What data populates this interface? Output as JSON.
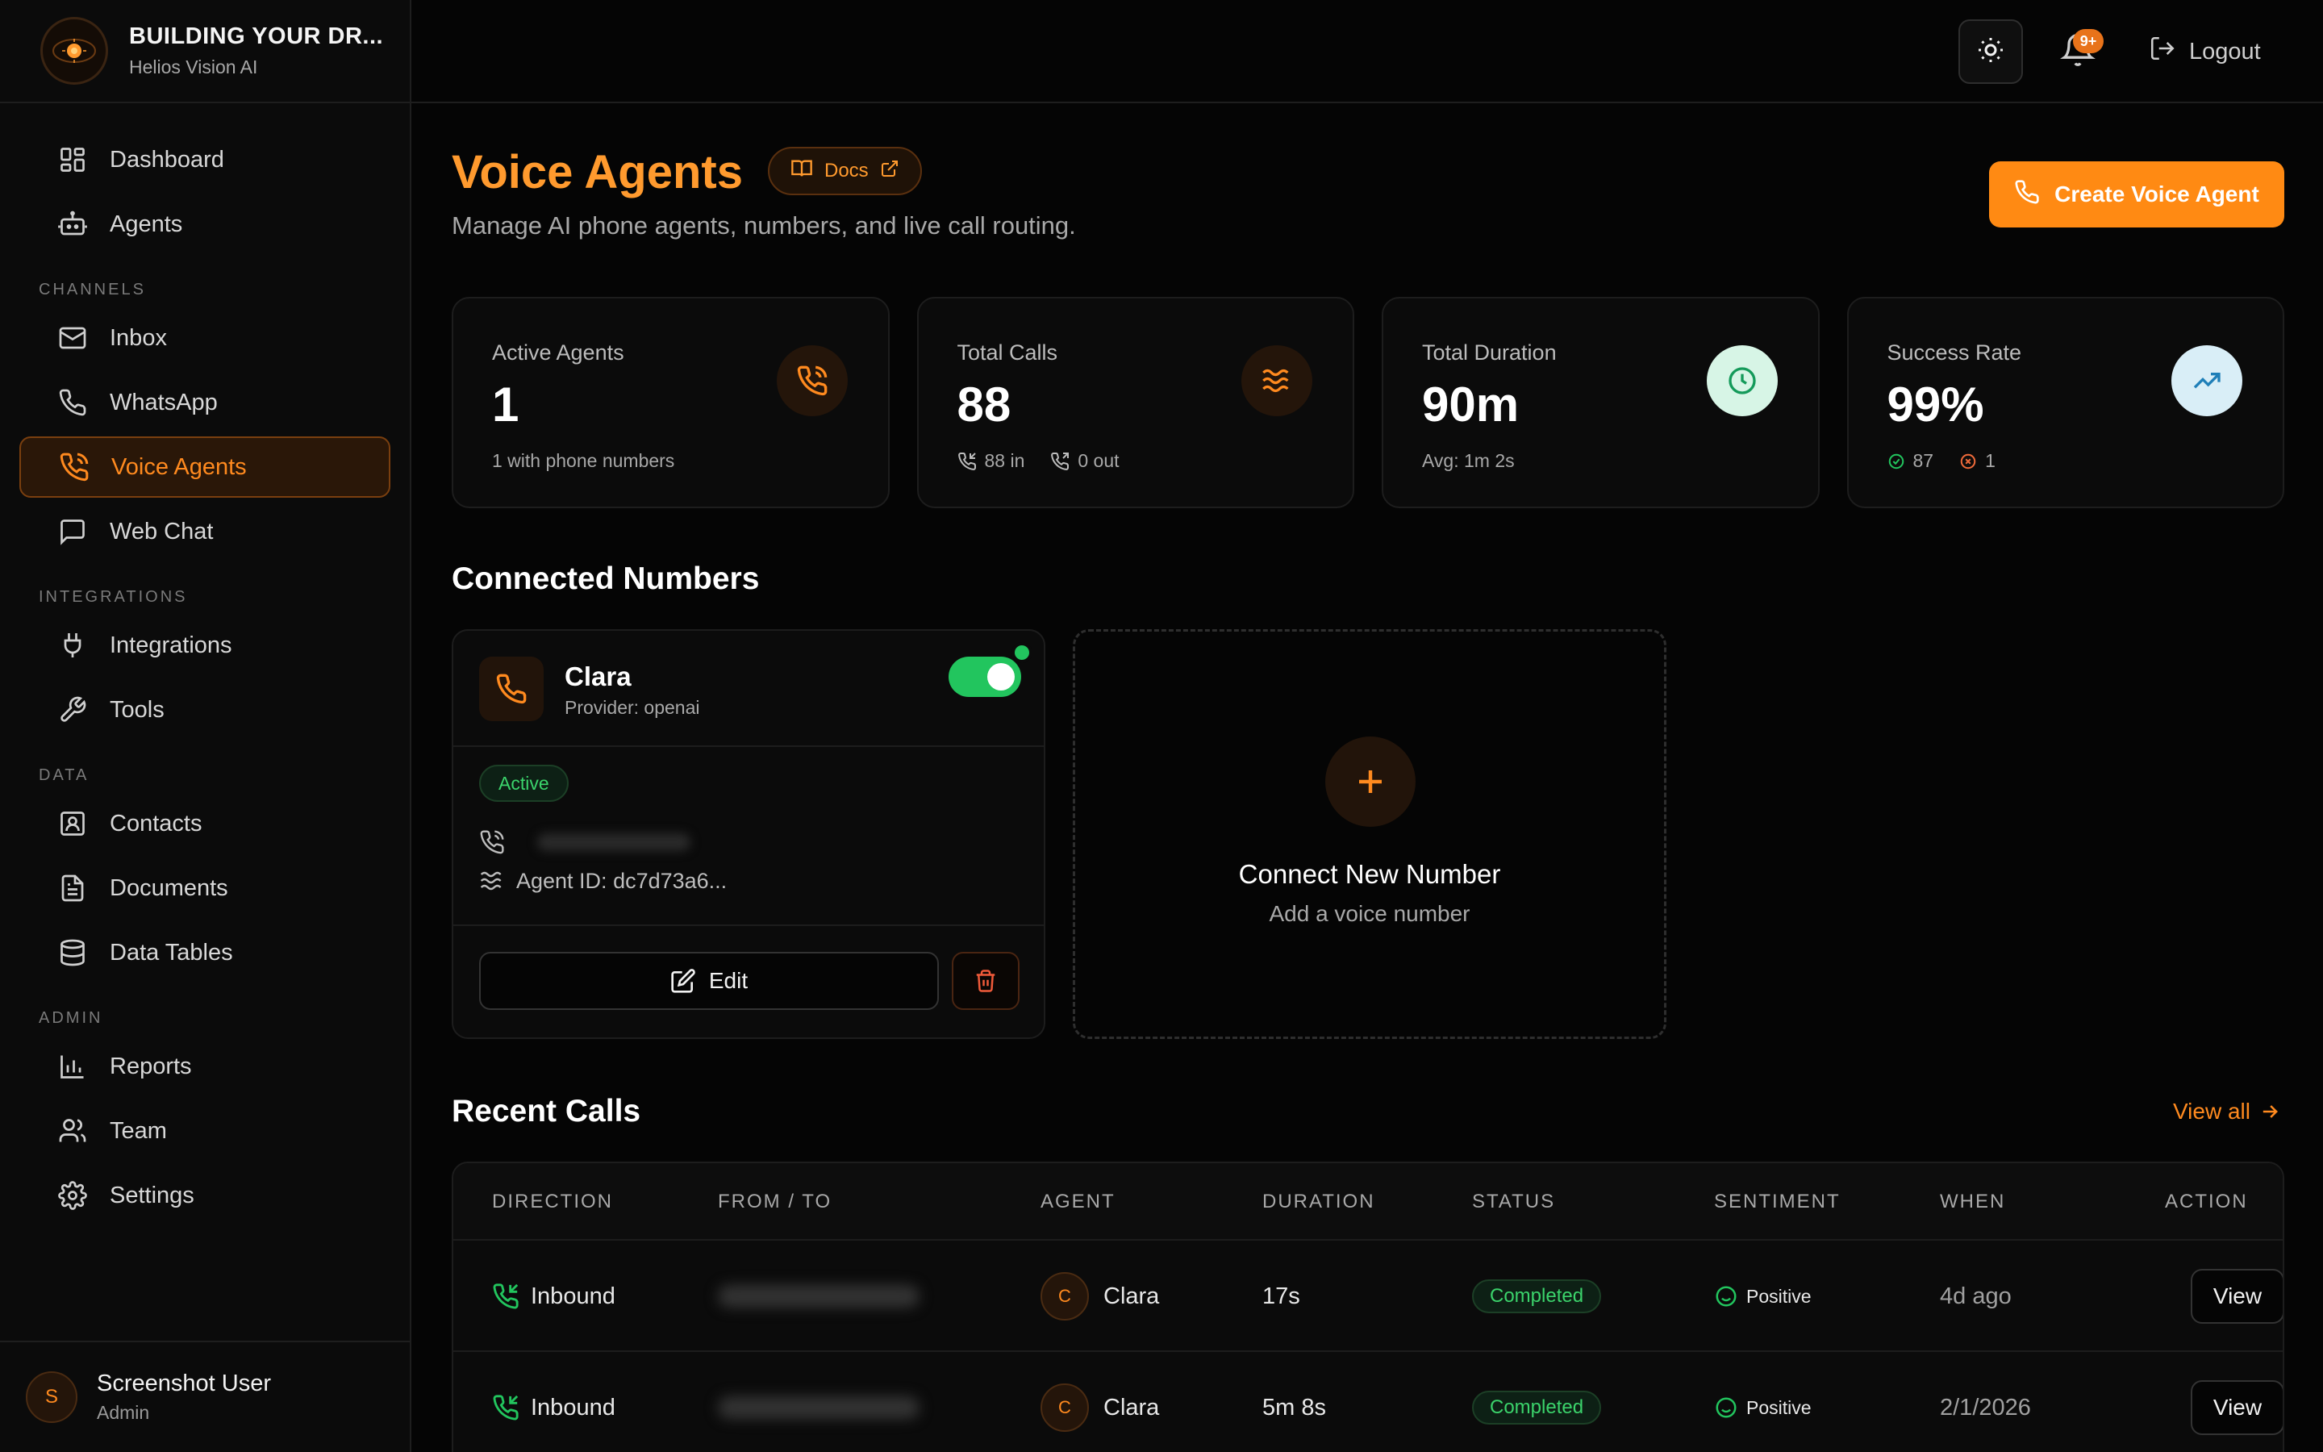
{
  "brand": {
    "title": "BUILDING YOUR DR...",
    "subtitle": "Helios Vision AI"
  },
  "colors": {
    "accent": "#ff8a13",
    "success": "#22c55e",
    "danger": "#ef4444"
  },
  "sidebar": {
    "top_items": [
      {
        "label": "Dashboard",
        "icon": "dashboard-icon"
      },
      {
        "label": "Agents",
        "icon": "bot-icon"
      }
    ],
    "sections": [
      {
        "title": "CHANNELS",
        "items": [
          {
            "label": "Inbox",
            "icon": "mail-icon"
          },
          {
            "label": "WhatsApp",
            "icon": "phone-icon"
          },
          {
            "label": "Voice Agents",
            "icon": "phone-call-icon",
            "active": true
          },
          {
            "label": "Web Chat",
            "icon": "chat-icon"
          }
        ]
      },
      {
        "title": "INTEGRATIONS",
        "items": [
          {
            "label": "Integrations",
            "icon": "plug-icon"
          },
          {
            "label": "Tools",
            "icon": "wrench-icon"
          }
        ]
      },
      {
        "title": "DATA",
        "items": [
          {
            "label": "Contacts",
            "icon": "contact-icon"
          },
          {
            "label": "Documents",
            "icon": "document-icon"
          },
          {
            "label": "Data Tables",
            "icon": "database-icon"
          }
        ]
      },
      {
        "title": "ADMIN",
        "items": [
          {
            "label": "Reports",
            "icon": "bar-chart-icon"
          },
          {
            "label": "Team",
            "icon": "users-icon"
          },
          {
            "label": "Settings",
            "icon": "gear-icon"
          }
        ]
      }
    ],
    "user": {
      "initial": "S",
      "name": "Screenshot User",
      "role": "Admin"
    }
  },
  "topbar": {
    "notifications_badge": "9+",
    "logout_label": "Logout"
  },
  "page": {
    "title": "Voice Agents",
    "docs_label": "Docs",
    "subtitle": "Manage AI phone agents, numbers, and live call routing.",
    "create_label": "Create Voice Agent"
  },
  "stats": {
    "active_agents": {
      "label": "Active Agents",
      "value": "1",
      "foot": "1 with phone numbers"
    },
    "total_calls": {
      "label": "Total Calls",
      "value": "88",
      "inbound": "88 in",
      "outbound": "0 out"
    },
    "total_duration": {
      "label": "Total Duration",
      "value": "90m",
      "foot": "Avg: 1m 2s"
    },
    "success_rate": {
      "label": "Success Rate",
      "value": "99%",
      "success": "87",
      "failed": "1"
    }
  },
  "connected": {
    "title": "Connected Numbers",
    "card": {
      "name": "Clara",
      "provider": "Provider: openai",
      "enabled": true,
      "status": "Active",
      "agent_id": "Agent ID: dc7d73a6...",
      "edit_label": "Edit"
    },
    "add": {
      "title": "Connect New Number",
      "subtitle": "Add a voice number"
    }
  },
  "recent": {
    "title": "Recent Calls",
    "view_all": "View all",
    "columns": [
      "DIRECTION",
      "FROM / TO",
      "AGENT",
      "DURATION",
      "STATUS",
      "SENTIMENT",
      "WHEN",
      "ACTION"
    ],
    "rows": [
      {
        "direction": "Inbound",
        "agent_initial": "C",
        "agent": "Clara",
        "duration": "17s",
        "status": "Completed",
        "sentiment": "Positive",
        "when": "4d ago",
        "action": "View"
      },
      {
        "direction": "Inbound",
        "agent_initial": "C",
        "agent": "Clara",
        "duration": "5m 8s",
        "status": "Completed",
        "sentiment": "Positive",
        "when": "2/1/2026",
        "action": "View"
      }
    ]
  }
}
